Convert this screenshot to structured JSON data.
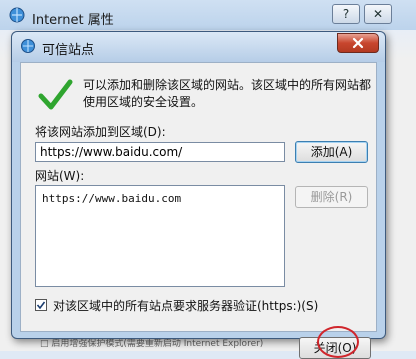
{
  "background_window": {
    "title": "Internet 属性",
    "help_button": "?",
    "close_button": "✕",
    "bottom_fragment": "□ 启用增强保护模式(需要重新启动 Internet Explorer)"
  },
  "dialog": {
    "title": "可信站点",
    "close_icon": "close-icon",
    "description": "可以添加和删除该区域的网站。该区域中的所有网站都使用区域的安全设置。",
    "add_label": "将该网站添加到区域(D):",
    "url_value": "https://www.baidu.com/",
    "add_button": "添加(A)",
    "sites_label": "网站(W):",
    "sites": [
      "https://www.baidu.com"
    ],
    "remove_button": "删除(R)",
    "require_verify_label": "对该区域中的所有站点要求服务器验证(https:)(S)",
    "require_verify_checked": true,
    "close_button": "关闭(O)"
  }
}
